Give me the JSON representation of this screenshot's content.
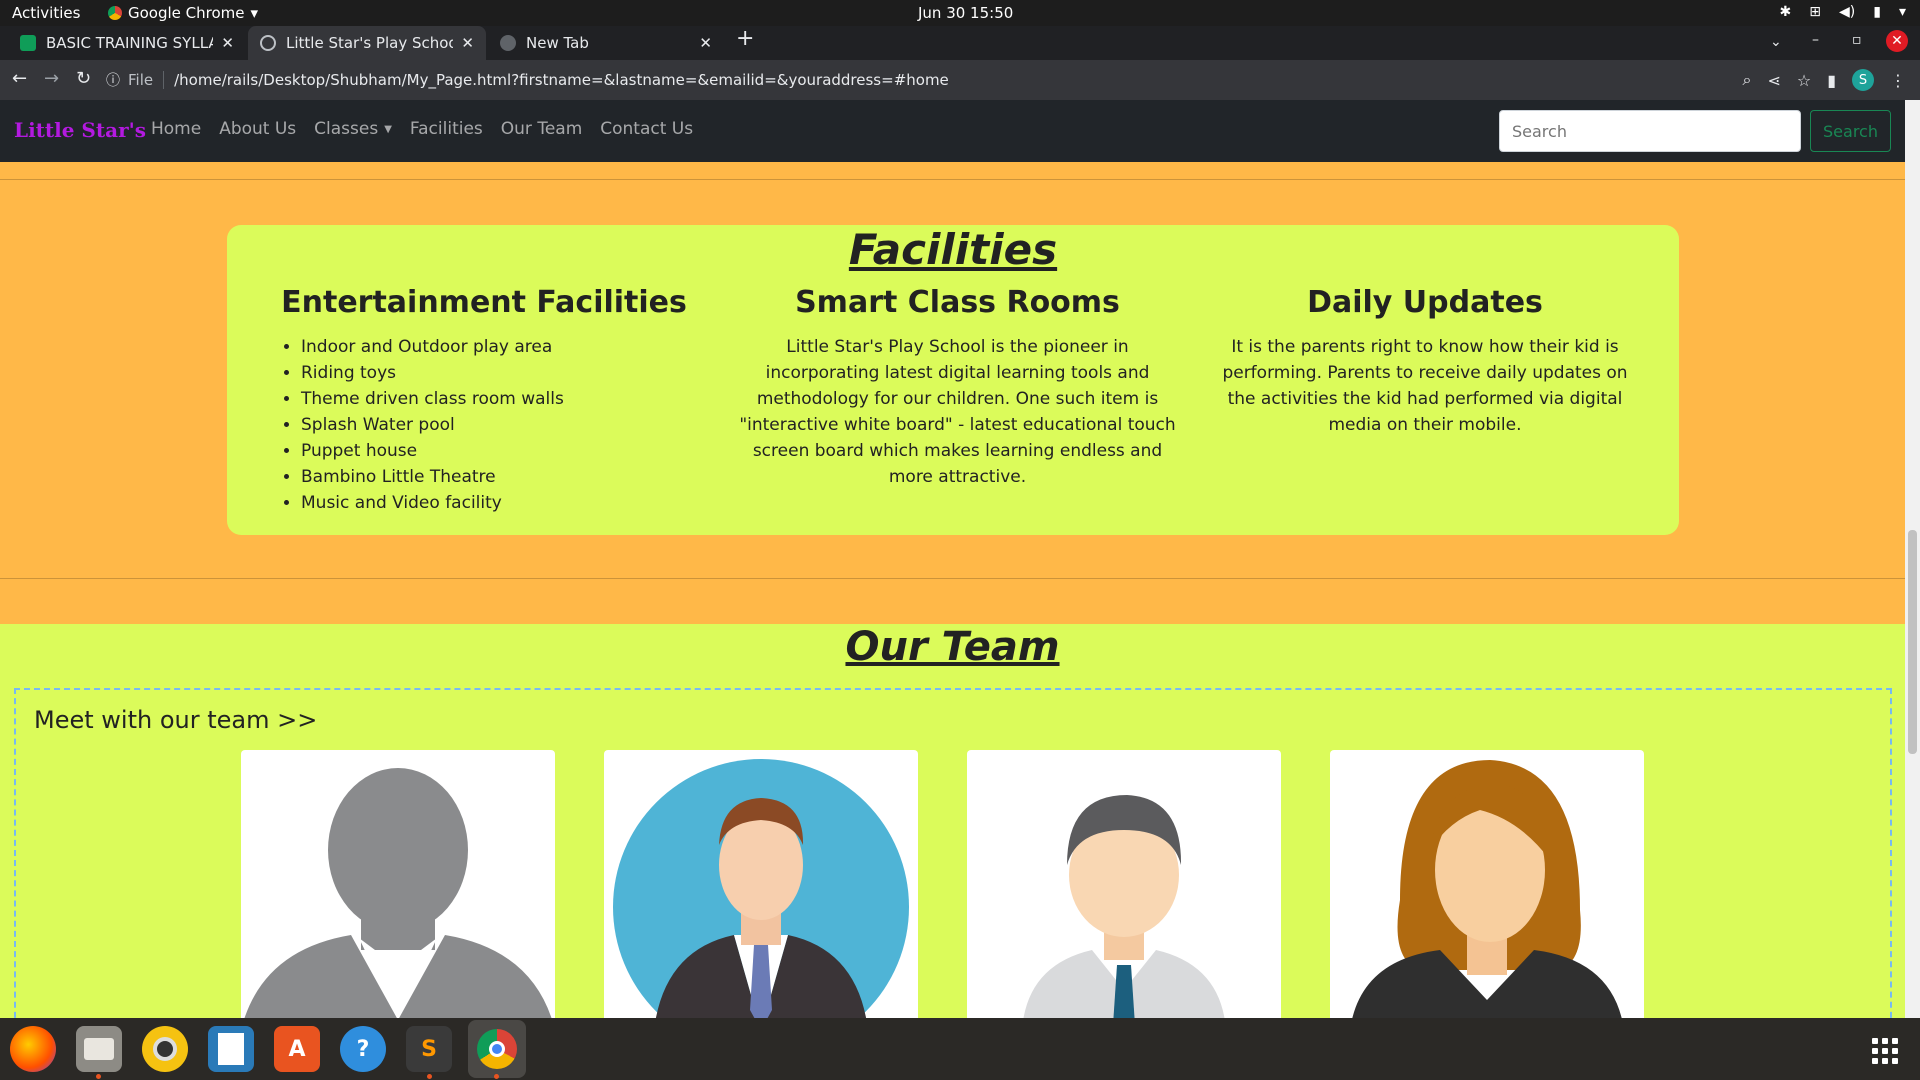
{
  "system": {
    "activities": "Activities",
    "app_menu": "Google Chrome",
    "clock": "Jun 30  15:50"
  },
  "browser": {
    "tabs": [
      {
        "title": "BASIC TRAINING SYLLABUS",
        "favicon": "sheets-icon",
        "color": "#0f9d58"
      },
      {
        "title": "Little Star's Play School",
        "favicon": "globe-icon"
      },
      {
        "title": "New Tab",
        "favicon": "chrome-icon"
      }
    ],
    "url_scheme": "File",
    "url": "/home/rails/Desktop/Shubham/My_Page.html?firstname=&lastname=&emailid=&youraddress=#home",
    "profile_initial": "S"
  },
  "navbar": {
    "brand": "Little Star's",
    "brand_color": "#b31ae0",
    "links": [
      "Home",
      "About Us",
      "Classes",
      "Facilities",
      "Our Team",
      "Contact Us"
    ],
    "search_placeholder": "Search",
    "search_button": "Search"
  },
  "facilities": {
    "title": "Facilities",
    "entertainment": {
      "heading": "Entertainment Facilities",
      "items": [
        "Indoor and Outdoor play area",
        "Riding toys",
        "Theme driven class room walls",
        "Splash Water pool",
        "Puppet house",
        "Bambino Little Theatre",
        "Music and Video facility"
      ]
    },
    "smart": {
      "heading": "Smart Class Rooms",
      "text": "Little Star's Play School is the pioneer in incorporating latest digital learning tools and methodology for our children. One such item is \"interactive white board\" - latest educational touch screen board which makes learning endless and more attractive."
    },
    "updates": {
      "heading": "Daily Updates",
      "text": "It is the parents right to know how their kid is performing. Parents to receive daily updates on the activities the kid had performed via digital media on their mobile."
    }
  },
  "team": {
    "title": "Our Team",
    "subtitle": "Meet with our team >>",
    "members": [
      "gray-silhouette-avatar",
      "businessman-avatar",
      "man-avatar",
      "woman-avatar"
    ]
  },
  "colors": {
    "page_bg": "#ffb848",
    "card_bg": "#dbfb5a",
    "navbar_bg": "#212529"
  },
  "dock": [
    "firefox-icon",
    "files-icon",
    "rhythmbox-icon",
    "writer-icon",
    "software-icon",
    "help-icon",
    "sublime-icon",
    "chrome-icon"
  ]
}
